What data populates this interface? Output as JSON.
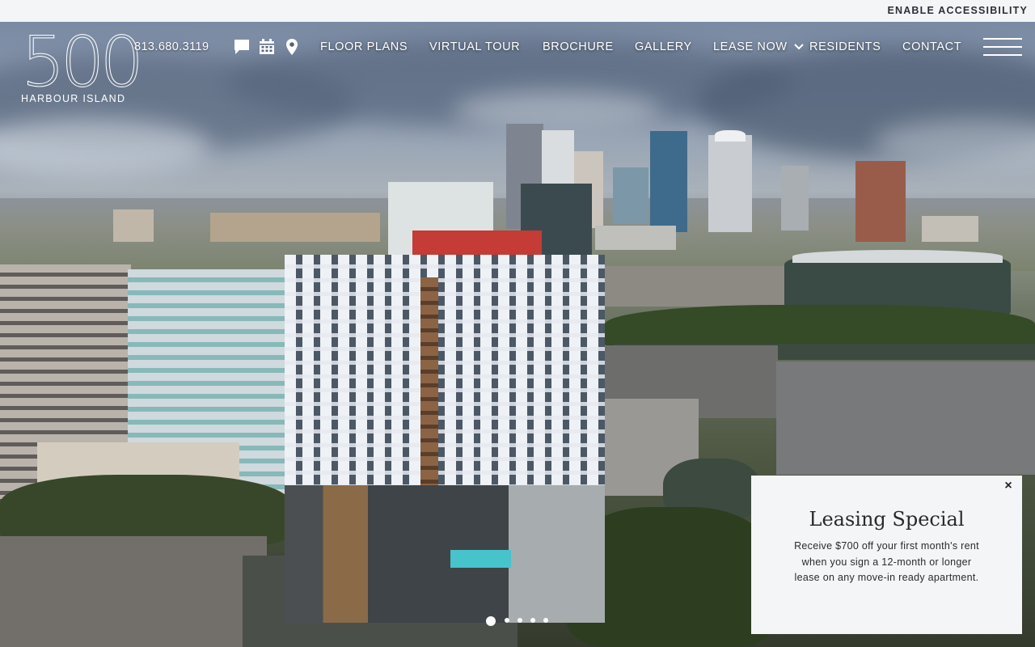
{
  "accessibility": {
    "label": "ENABLE ACCESSIBILITY"
  },
  "logo": {
    "number": "500",
    "subtitle": "HARBOUR ISLAND"
  },
  "header": {
    "phone": "813.680.3119",
    "icons": [
      "chat-icon",
      "calendar-icon",
      "location-pin-icon"
    ],
    "nav": [
      {
        "label": "FLOOR PLANS"
      },
      {
        "label": "VIRTUAL TOUR"
      },
      {
        "label": "BROCHURE"
      },
      {
        "label": "GALLERY"
      },
      {
        "label": "LEASE NOW",
        "has_dropdown": true
      },
      {
        "label": "RESIDENTS"
      },
      {
        "label": "CONTACT"
      }
    ],
    "menu_icon": "hamburger-menu-icon"
  },
  "carousel": {
    "slide_count": 5,
    "active_index": 0
  },
  "popup": {
    "close_label": "×",
    "title": "Leasing Special",
    "body": "Receive $700 off your first month's rent when you sign a 12-month or longer lease on any move-in ready apartment."
  },
  "colors": {
    "text_light": "#ffffff",
    "popup_bg": "#f4f5f7",
    "bar_bg": "#f4f5f7",
    "dark_text": "#2a2a2a"
  }
}
